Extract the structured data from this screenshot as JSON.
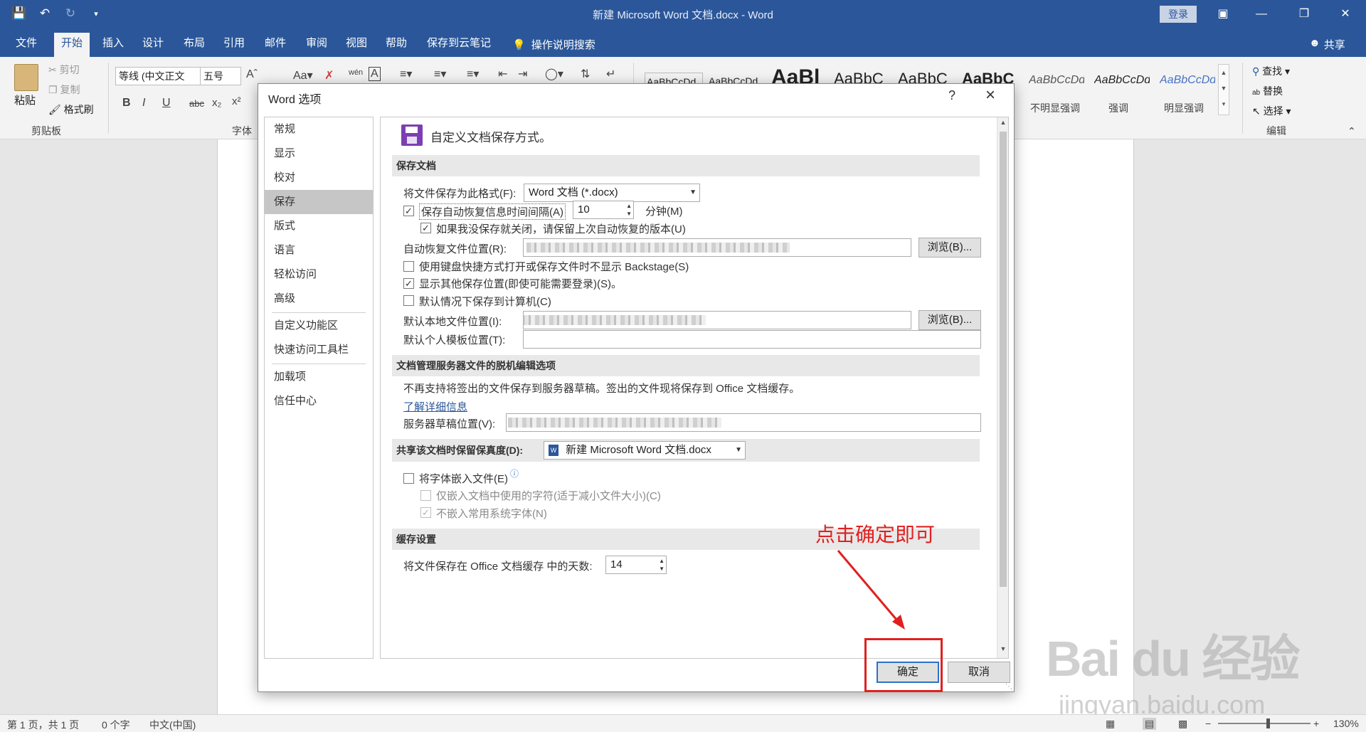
{
  "window": {
    "title": "新建 Microsoft Word 文档.docx  -  Word",
    "login_label": "登录",
    "share_label": "共享"
  },
  "menu_tabs": [
    "文件",
    "开始",
    "插入",
    "设计",
    "布局",
    "引用",
    "邮件",
    "审阅",
    "视图",
    "帮助",
    "保存到云笔记"
  ],
  "active_tab": "开始",
  "tell_me": "操作说明搜索",
  "ribbon": {
    "paste_label": "粘贴",
    "cut_label": "剪切",
    "copy_label": "复制",
    "format_painter_label": "格式刷",
    "clipboard_group": "剪贴板",
    "font_name": "等线 (中文正文",
    "font_size": "五号",
    "font_group": "字体",
    "styles": [
      {
        "preview": "AaBbCcDd",
        "name": ""
      },
      {
        "preview": "AaBbCcDd",
        "name": ""
      },
      {
        "preview": "AaBl",
        "name": ""
      },
      {
        "preview": "AaBbC",
        "name": ""
      },
      {
        "preview": "AaBbC",
        "name": ""
      },
      {
        "preview": "AaBbC",
        "name": ""
      },
      {
        "preview": "AaBbCcDd",
        "name": "不明显强调"
      },
      {
        "preview": "AaBbCcDd",
        "name": "强调"
      },
      {
        "preview": "AaBbCcDd",
        "name": "明显强调"
      }
    ],
    "find_label": "查找",
    "replace_label": "替换",
    "select_label": "选择",
    "edit_group": "编辑"
  },
  "dialog": {
    "title": "Word 选项",
    "help": "?",
    "nav_items": [
      "常规",
      "显示",
      "校对",
      "保存",
      "版式",
      "语言",
      "轻松访问",
      "高级",
      "自定义功能区",
      "快速访问工具栏",
      "加载项",
      "信任中心"
    ],
    "active_nav": "保存",
    "header": "自定义文档保存方式。",
    "sections": {
      "save_docs": "保存文档",
      "offline": "文档管理服务器文件的脱机编辑选项",
      "fidelity": "共享该文档时保留保真度(D):",
      "cache": "缓存设置"
    },
    "save_format_label": "将文件保存为此格式(F):",
    "save_format_value": "Word 文档 (*.docx)",
    "autorecover_label": "保存自动恢复信息时间间隔(A)",
    "autorecover_value": "10",
    "minutes_label": "分钟(M)",
    "keep_last_label": "如果我没保存就关闭，请保留上次自动恢复的版本(U)",
    "autorecover_location_label": "自动恢复文件位置(R):",
    "browse_label": "浏览(B)...",
    "no_backstage_label": "使用键盘快捷方式打开或保存文件时不显示 Backstage(S)",
    "show_other_label": "显示其他保存位置(即使可能需要登录)(S)。",
    "save_to_computer_label": "默认情况下保存到计算机(C)",
    "default_local_label": "默认本地文件位置(I):",
    "template_location_label": "默认个人模板位置(T):",
    "offline_note": "不再支持将签出的文件保存到服务器草稿。签出的文件现将保存到 Office 文档缓存。",
    "learn_more": "了解详细信息",
    "server_drafts_label": "服务器草稿位置(V):",
    "fidelity_doc": "新建 Microsoft Word 文档.docx",
    "embed_fonts_label": "将字体嵌入文件(E)",
    "embed_used_only_label": "仅嵌入文档中使用的字符(适于减小文件大小)(C)",
    "no_common_fonts_label": "不嵌入常用系统字体(N)",
    "cache_days_label": "将文件保存在 Office 文档缓存 中的天数:",
    "cache_days_value": "14",
    "ok_label": "确定",
    "cancel_label": "取消"
  },
  "annotation": "点击确定即可",
  "statusbar": {
    "page": "第 1 页，共 1 页",
    "words": "0 个字",
    "language": "中文(中国)",
    "zoom": "130%"
  },
  "watermark": {
    "line1": "Bai du 经验",
    "line2": "jingyan.baidu.com"
  },
  "colors": {
    "titlebar": "#2b579a",
    "annotation": "#e02020",
    "save_icon": "#7b3fb3"
  }
}
